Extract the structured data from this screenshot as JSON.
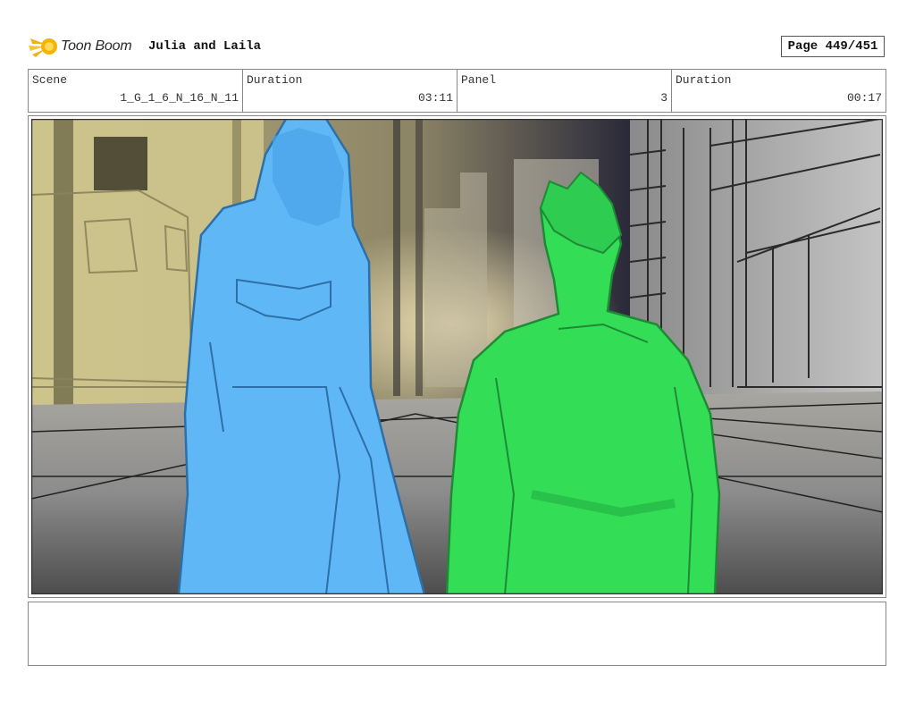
{
  "header": {
    "logo_text": "Toon Boom",
    "title": "Julia and Laila",
    "page": "Page 449/451"
  },
  "info": {
    "scene_label": "Scene",
    "scene_value": "1_G_1_6_N_16_N_11",
    "duration_label": "Duration",
    "duration_value": "03:11",
    "panel_label": "Panel",
    "panel_value": "3",
    "panel_duration_label": "Duration",
    "panel_duration_value": "00:17"
  },
  "panel": {
    "image_icon": "storyboard-sketch",
    "colors": {
      "woman": "#5fb8f5",
      "man": "#33dd55",
      "background_left": "#d8cf9a",
      "background_right": "#8a8a8a"
    }
  },
  "notes": {
    "text": ""
  }
}
